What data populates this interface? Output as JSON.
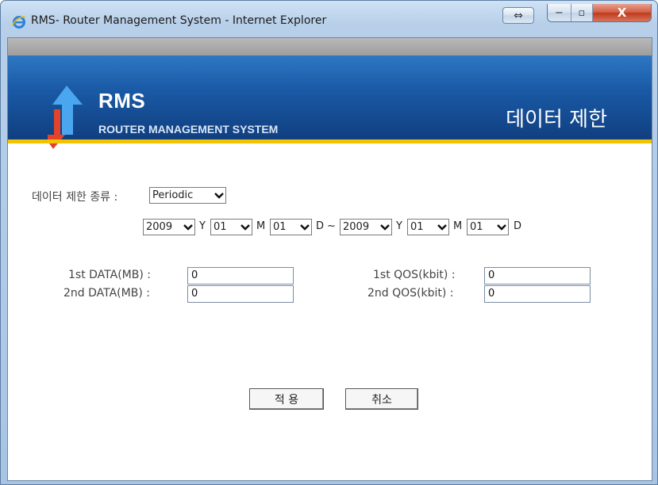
{
  "window": {
    "title": "RMS- Router Management System - Internet Explorer",
    "restore_glyph": "⇔",
    "minimize_glyph": "−",
    "maximize_glyph": "▫",
    "close_glyph": "X"
  },
  "banner": {
    "brand": "RMS",
    "brand_sub": "ROUTER MANAGEMENT SYSTEM",
    "page_heading": "데이터 제한",
    "accent_color": "#f2c300"
  },
  "form": {
    "type_label": "데이터 제한 종류 :",
    "type_value": "Periodic",
    "start": {
      "year": "2009",
      "year_unit": "Y",
      "month": "01",
      "month_unit": "M",
      "day": "01",
      "day_unit": "D"
    },
    "range_sep": "~",
    "end": {
      "year": "2009",
      "year_unit": "Y",
      "month": "01",
      "month_unit": "M",
      "day": "01",
      "day_unit": "D"
    },
    "fields": {
      "data1_label": "1st DATA(MB) :",
      "data1_value": "0",
      "data2_label": "2nd DATA(MB) :",
      "data2_value": "0",
      "qos1_label": "1st QOS(kbit) :",
      "qos1_value": "0",
      "qos2_label": "2nd QOS(kbit) :",
      "qos2_value": "0"
    },
    "apply_label": "적  용",
    "cancel_label": "취소"
  }
}
